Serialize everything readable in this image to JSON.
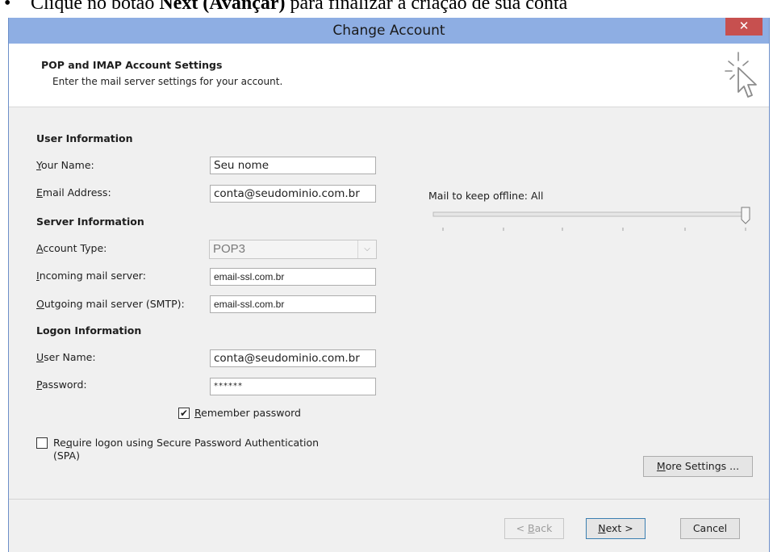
{
  "caption": {
    "bullet": "•",
    "prefix": "Clique no botão ",
    "bold_text": "Next (Avançar)",
    "suffix": " para finalizar a criação de sua conta"
  },
  "window": {
    "title": "Change Account",
    "close_glyph": "✕"
  },
  "header": {
    "title": "POP and IMAP Account Settings",
    "subtitle": "Enter the mail server settings for your account.",
    "icon": "cursor-sparkle-icon"
  },
  "user_info": {
    "heading": "User Information",
    "your_name": {
      "label_key": "Y",
      "label_rest": "our Name:",
      "value": "Seu nome"
    },
    "email": {
      "label_key": "E",
      "label_rest": "mail Address:",
      "value": "conta@seudominio.com.br"
    }
  },
  "server_info": {
    "heading": "Server Information",
    "account_type": {
      "label_key": "A",
      "label_rest": "ccount Type:",
      "value": "POP3"
    },
    "incoming": {
      "label_key": "I",
      "label_rest": "ncoming mail server:",
      "value": "email-ssl.com.br"
    },
    "outgoing": {
      "label_key": "O",
      "label_rest": "utgoing mail server (SMTP):",
      "value": "email-ssl.com.br"
    }
  },
  "logon_info": {
    "heading": "Logon Information",
    "user_name": {
      "label_key": "U",
      "label_rest": "ser Name:",
      "value": "conta@seudominio.com.br"
    },
    "password": {
      "label_key": "P",
      "label_rest": "assword:",
      "value": "******"
    },
    "remember": {
      "label_key": "R",
      "label_rest": "emember password",
      "checked": true
    },
    "spa": {
      "label_pre": "Re",
      "label_key": "q",
      "label_rest": "uire logon using Secure Password Authentication",
      "label_line2": "(SPA)",
      "checked": false
    }
  },
  "offline": {
    "label": "Mail to keep offline:",
    "value": "All",
    "level": 1.0
  },
  "buttons": {
    "more_settings_key": "M",
    "more_settings_rest": "ore Settings ...",
    "back_pre": "< ",
    "back_key": "B",
    "back_rest": "ack",
    "next_key": "N",
    "next_rest": "ext >",
    "cancel": "Cancel"
  },
  "colors": {
    "titlebar": "#8eaee3",
    "close": "#c7504f",
    "default_button_border": "#3c7fb1"
  }
}
